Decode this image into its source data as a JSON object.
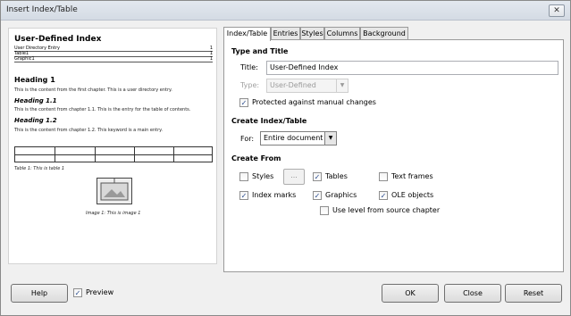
{
  "window": {
    "title": "Insert Index/Table",
    "close_glyph": "✕"
  },
  "preview": {
    "title": "User-Defined Index",
    "toc": [
      {
        "label": "User Directory Entry",
        "page": "1"
      },
      {
        "label": "Table1",
        "page": "1"
      },
      {
        "label": "Graphic1",
        "page": "1"
      }
    ],
    "heading1": "Heading 1",
    "body1": "This is the content from the first chapter. This is a user directory entry.",
    "heading11": "Heading 1.1",
    "body11": "This is the content from chapter 1.1. This is the entry for the table of contents.",
    "heading12": "Heading 1.2",
    "body12": "This is the content from chapter 1.2. This keyword is a main entry.",
    "table_caption": "Table 1: This is table 1",
    "image_caption": "Image 1: This is image 1"
  },
  "tabs": [
    "Index/Table",
    "Entries",
    "Styles",
    "Columns",
    "Background"
  ],
  "type_and_title": {
    "section": "Type and Title",
    "title_label": "Title:",
    "title_value": "User-Defined Index",
    "type_label": "Type:",
    "type_value": "User-Defined",
    "protected_label": "Protected against manual changes",
    "protected_checked": true
  },
  "create_index": {
    "section": "Create Index/Table",
    "for_label": "For:",
    "for_value": "Entire document"
  },
  "create_from": {
    "section": "Create From",
    "styles_label": "Styles",
    "styles_checked": false,
    "ellipsis": "...",
    "tables_label": "Tables",
    "tables_checked": true,
    "text_frames_label": "Text frames",
    "text_frames_checked": false,
    "index_marks_label": "Index marks",
    "index_marks_checked": true,
    "graphics_label": "Graphics",
    "graphics_checked": true,
    "ole_label": "OLE objects",
    "ole_checked": true,
    "use_level_label": "Use level from source chapter",
    "use_level_checked": false
  },
  "bottom": {
    "help": "Help",
    "preview_label": "Preview",
    "preview_checked": true,
    "ok": "OK",
    "close": "Close",
    "reset": "Reset"
  },
  "check_glyph": "✓"
}
